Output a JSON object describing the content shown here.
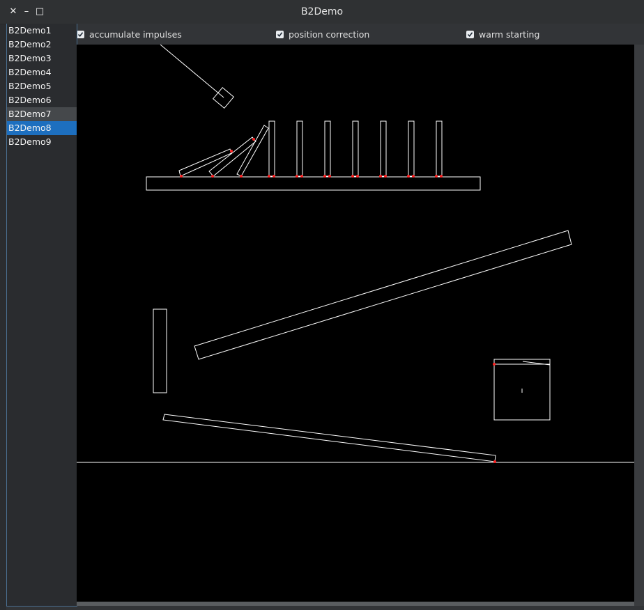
{
  "window": {
    "title": "B2Demo"
  },
  "titlebar": {
    "close_glyph": "✕",
    "minimize_glyph": "–",
    "maximize_glyph": "□"
  },
  "toolbar": {
    "checkboxes": [
      {
        "label": "accumulate impulses",
        "checked": true
      },
      {
        "label": "position correction",
        "checked": true
      },
      {
        "label": "warm starting",
        "checked": true
      }
    ]
  },
  "demo_list": {
    "items": [
      "B2Demo1",
      "B2Demo2",
      "B2Demo3",
      "B2Demo4",
      "B2Demo5",
      "B2Demo6",
      "B2Demo7",
      "B2Demo8",
      "B2Demo9"
    ],
    "hovered": "B2Demo7",
    "selected": "B2Demo8"
  },
  "colors": {
    "accent": "#1d6fbf",
    "canvas_bg": "#000000",
    "shape_stroke": "#ffffff",
    "contact_point": "#ff0000"
  }
}
